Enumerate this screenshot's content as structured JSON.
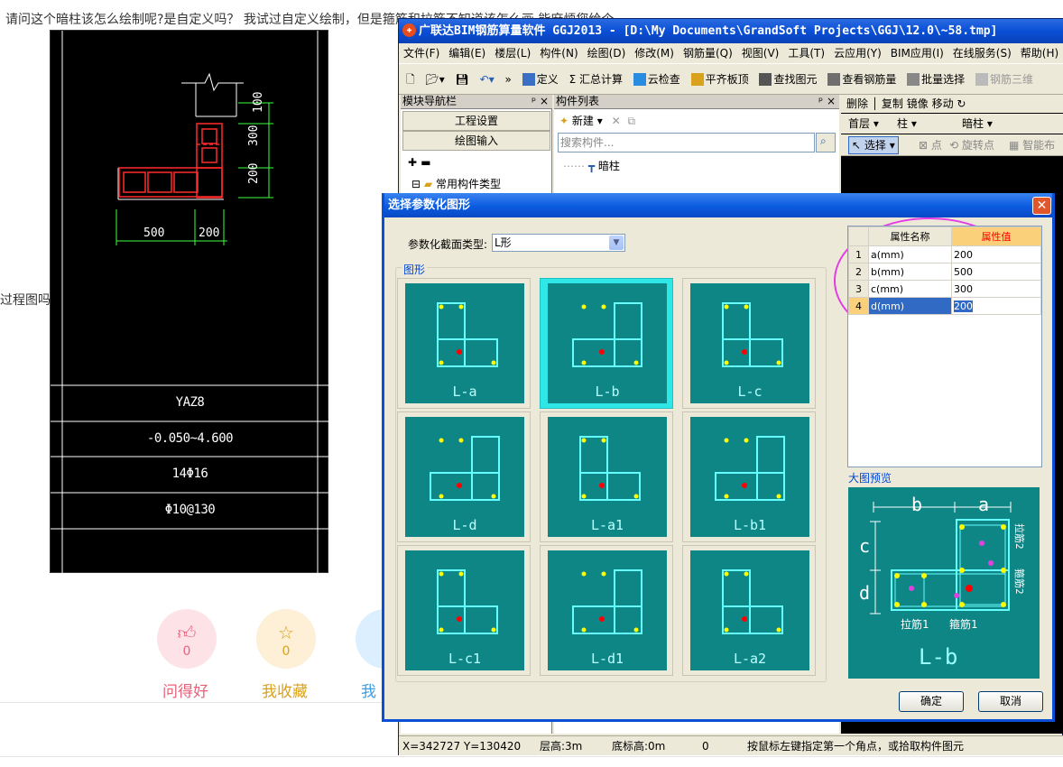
{
  "question": {
    "text": "请问这个暗柱该怎么绘制呢?是自定义吗？ 我试过自定义绘制，但是箍筋和拉筋不知道该怎么画 能麻烦您给个",
    "side_text": "过程图吗"
  },
  "cad_drawing": {
    "dims_vertical": [
      "100",
      "300",
      "200"
    ],
    "dims_horizontal": [
      "500",
      "200"
    ],
    "table_rows": [
      "YAZ8",
      "-0.050~4.600",
      "14Φ16",
      "Φ10@130"
    ]
  },
  "reactions": [
    {
      "icon": "thumbs-up-icon",
      "count": "0",
      "label": "问得好",
      "color": "#e8627a",
      "bg": "#fde3e8"
    },
    {
      "icon": "star-icon",
      "count": "0",
      "label": "我收藏",
      "color": "#d9a21d",
      "bg": "#fdf0d6"
    },
    {
      "icon": "share-icon",
      "count": "",
      "label": "我",
      "color": "#3b9ee0",
      "bg": "#dcefff"
    }
  ],
  "app": {
    "title": "广联达BIM钢筋算量软件 GGJ2013 - [D:\\My Documents\\GrandSoft Projects\\GGJ\\12.0\\~58.tmp]",
    "menu": [
      "文件(F)",
      "编辑(E)",
      "楼层(L)",
      "构件(N)",
      "绘图(D)",
      "修改(M)",
      "钢筋量(Q)",
      "视图(V)",
      "工具(T)",
      "云应用(Y)",
      "BIM应用(I)",
      "在线服务(S)",
      "帮助(H)"
    ],
    "toolbar": [
      "定义",
      "Σ 汇总计算",
      "云检查",
      "平齐板顶",
      "查找图元",
      "查看钢筋量",
      "批量选择",
      "钢筋三维"
    ],
    "nav_panel": {
      "title": "模块导航栏",
      "buttons": [
        "工程设置",
        "绘图输入"
      ],
      "tree_item": "常用构件类型"
    },
    "component_panel": {
      "title": "构件列表",
      "new_label": "新建",
      "search_placeholder": "搜索构件...",
      "item": "暗柱"
    },
    "right_panel": {
      "tools": [
        "删除",
        "复制",
        "镜像",
        "移动"
      ],
      "floor": "首层",
      "category": "柱",
      "type": "暗柱",
      "select_label": "选择",
      "draw_tools": [
        "点",
        "旋转点",
        "智能布"
      ]
    },
    "status": {
      "coords": "X=342727 Y=130420",
      "floor_height": "层高:3m",
      "base_height": "底标高:0m",
      "value": "0",
      "hint": "按鼠标左键指定第一个角点，或拾取构件图元"
    }
  },
  "dialog": {
    "title": "选择参数化图形",
    "type_label": "参数化截面类型:",
    "type_value": "L形",
    "shapes_label": "图形",
    "shapes": [
      "L-a",
      "L-b",
      "L-c",
      "L-d",
      "L-a1",
      "L-b1",
      "L-c1",
      "L-d1",
      "L-a2"
    ],
    "selected_shape": "L-b",
    "properties_header": [
      "属性名称",
      "属性值"
    ],
    "properties": [
      {
        "idx": "1",
        "name": "a(mm)",
        "value": "200"
      },
      {
        "idx": "2",
        "name": "b(mm)",
        "value": "500"
      },
      {
        "idx": "3",
        "name": "c(mm)",
        "value": "300"
      },
      {
        "idx": "4",
        "name": "d(mm)",
        "value": "200"
      }
    ],
    "preview_label": "大图预览",
    "preview": {
      "dim_top": [
        "b",
        "a"
      ],
      "dim_left": [
        "c",
        "d"
      ],
      "tie_label": "拉筋2",
      "stirrup2": "箍筋2",
      "tie1": "拉筋1",
      "stirrup1": "箍筋1",
      "name": "L-b"
    },
    "ok": "确定",
    "cancel": "取消"
  }
}
